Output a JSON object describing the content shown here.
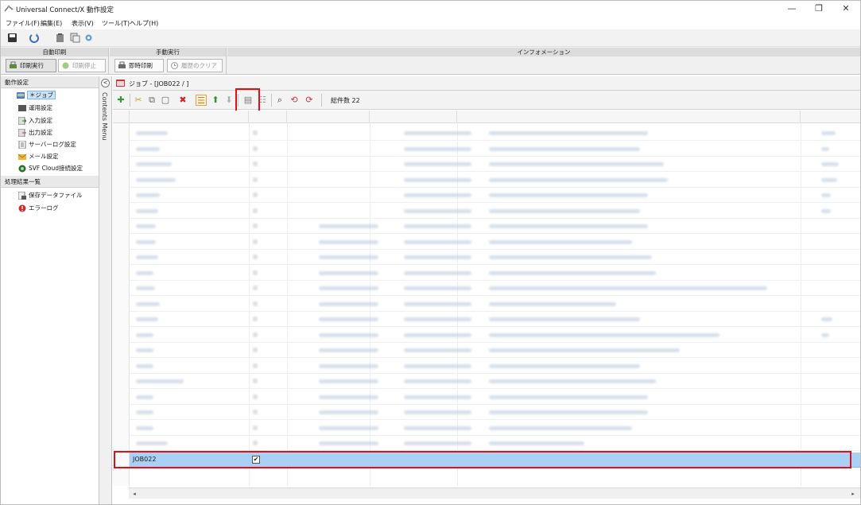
{
  "window": {
    "title": "Universal Connect/X 動作設定",
    "controls": {
      "minimize": "—",
      "restore": "❐",
      "close": "✕"
    }
  },
  "menu": [
    "ファイル(F)",
    "編集(E)",
    "表示(V)",
    "ツール(T)",
    "ヘルプ(H)"
  ],
  "ribbon": {
    "auto_print": {
      "header": "自動印刷",
      "start_label": "印刷実行",
      "stop_label": "印刷停止"
    },
    "manual": {
      "header": "手動実行",
      "run_now_label": "即時印刷",
      "clear_history_label": "履歴のクリア"
    },
    "info": {
      "header": "インフォメーション"
    }
  },
  "left_panel": {
    "settings_header": "動作設定",
    "settings_items": [
      "＊ジョブ",
      "運用設定",
      "入力設定",
      "出力設定",
      "サーバーログ設定",
      "メール設定",
      "SVF Cloud接続設定"
    ],
    "results_header": "処理結果一覧",
    "results_items": [
      "保存データファイル",
      "エラーログ"
    ]
  },
  "contents_menu": {
    "label": "Contents Menu",
    "collapse": "<"
  },
  "breadcrumb": "ジョブ - [JOB022 / ]",
  "toolbar": {
    "count_label": "総件数 22"
  },
  "table": {
    "selected_row": {
      "name": "JOB022",
      "checked": "✔"
    }
  },
  "scrollbar": {
    "left": "◂",
    "right": "▸"
  },
  "colors": {
    "selection": "#a9d1f5",
    "highlight": "#e0101a",
    "ribbon_header": "#dcdcdc"
  }
}
